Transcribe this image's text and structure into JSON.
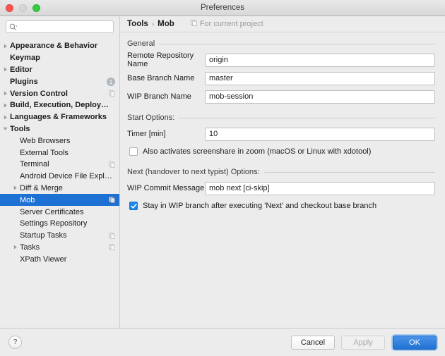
{
  "window": {
    "title": "Preferences",
    "traffic": {
      "close": "close-button",
      "minimize": "minimize-button",
      "zoom": "zoom-button"
    }
  },
  "sidebar": {
    "search": {
      "value": "",
      "placeholder": ""
    },
    "items": [
      {
        "label": "Appearance & Behavior",
        "level": 0,
        "arrow": "collapsed",
        "badge": null,
        "copy_icon": false,
        "selected": false
      },
      {
        "label": "Keymap",
        "level": 0,
        "arrow": "none",
        "badge": null,
        "copy_icon": false,
        "selected": false
      },
      {
        "label": "Editor",
        "level": 0,
        "arrow": "collapsed",
        "badge": null,
        "copy_icon": false,
        "selected": false
      },
      {
        "label": "Plugins",
        "level": 0,
        "arrow": "none",
        "badge": "1",
        "copy_icon": false,
        "selected": false
      },
      {
        "label": "Version Control",
        "level": 0,
        "arrow": "collapsed",
        "badge": null,
        "copy_icon": true,
        "selected": false
      },
      {
        "label": "Build, Execution, Deployment",
        "level": 0,
        "arrow": "collapsed",
        "badge": null,
        "copy_icon": false,
        "selected": false
      },
      {
        "label": "Languages & Frameworks",
        "level": 0,
        "arrow": "collapsed",
        "badge": null,
        "copy_icon": false,
        "selected": false
      },
      {
        "label": "Tools",
        "level": 0,
        "arrow": "expanded",
        "badge": null,
        "copy_icon": false,
        "selected": false
      },
      {
        "label": "Web Browsers",
        "level": 1,
        "arrow": "none",
        "badge": null,
        "copy_icon": false,
        "selected": false
      },
      {
        "label": "External Tools",
        "level": 1,
        "arrow": "none",
        "badge": null,
        "copy_icon": false,
        "selected": false
      },
      {
        "label": "Terminal",
        "level": 1,
        "arrow": "none",
        "badge": null,
        "copy_icon": true,
        "selected": false
      },
      {
        "label": "Android Device File Explorer",
        "level": 1,
        "arrow": "none",
        "badge": null,
        "copy_icon": false,
        "selected": false
      },
      {
        "label": "Diff & Merge",
        "level": 1,
        "arrow": "collapsed",
        "badge": null,
        "copy_icon": false,
        "selected": false
      },
      {
        "label": "Mob",
        "level": 1,
        "arrow": "none",
        "badge": null,
        "copy_icon": true,
        "selected": true
      },
      {
        "label": "Server Certificates",
        "level": 1,
        "arrow": "none",
        "badge": null,
        "copy_icon": false,
        "selected": false
      },
      {
        "label": "Settings Repository",
        "level": 1,
        "arrow": "none",
        "badge": null,
        "copy_icon": false,
        "selected": false
      },
      {
        "label": "Startup Tasks",
        "level": 1,
        "arrow": "none",
        "badge": null,
        "copy_icon": true,
        "selected": false
      },
      {
        "label": "Tasks",
        "level": 1,
        "arrow": "collapsed",
        "badge": null,
        "copy_icon": true,
        "selected": false
      },
      {
        "label": "XPath Viewer",
        "level": 1,
        "arrow": "none",
        "badge": null,
        "copy_icon": false,
        "selected": false
      }
    ]
  },
  "breadcrumb": {
    "parent": "Tools",
    "separator": "›",
    "current": "Mob",
    "scope_label": "For current project"
  },
  "sections": {
    "general": {
      "title": "General",
      "fields": [
        {
          "label": "Remote Repository Name",
          "value": "origin"
        },
        {
          "label": "Base Branch Name",
          "value": "master"
        },
        {
          "label": "WIP Branch Name",
          "value": "mob-session"
        }
      ]
    },
    "start": {
      "title": "Start Options:",
      "fields": [
        {
          "label": "Timer [min]",
          "value": "10"
        }
      ],
      "checkbox": {
        "label": "Also activates screenshare in zoom (macOS or Linux with xdotool)",
        "checked": false
      }
    },
    "next": {
      "title": "Next (handover to next typist) Options:",
      "fields": [
        {
          "label": "WIP Commit Message",
          "value": "mob next [ci-skip]"
        }
      ],
      "checkbox": {
        "label": "Stay in WIP branch after executing 'Next' and checkout base branch",
        "checked": true
      }
    }
  },
  "footer": {
    "help": "?",
    "cancel": "Cancel",
    "apply": "Apply",
    "ok": "OK",
    "apply_disabled": true
  },
  "colors": {
    "selection_blue": "#1e71d4",
    "primary_button": "#2071d4",
    "checkbox_checked": "#1e87f0",
    "window_bg": "#ececec"
  }
}
